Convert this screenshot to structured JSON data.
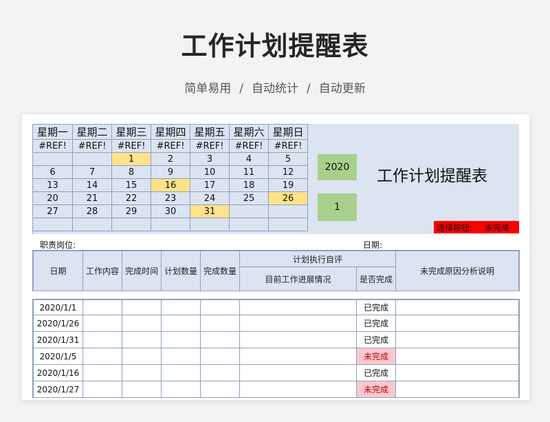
{
  "page": {
    "title": "工作计划提醒表",
    "subtitle": [
      "简单易用",
      "自动统计",
      "自动更新"
    ],
    "separator": "/"
  },
  "calendar": {
    "weekdays": [
      "星期一",
      "星期二",
      "星期三",
      "星期四",
      "星期五",
      "星期六",
      "星期日"
    ],
    "ref_row": [
      "#REF!",
      "#REF!",
      "#REF!",
      "#REF!",
      "#REF!",
      "#REF!",
      "#REF!"
    ],
    "weeks": [
      [
        "",
        "",
        "1",
        "2",
        "3",
        "4",
        "5"
      ],
      [
        "6",
        "7",
        "8",
        "9",
        "10",
        "11",
        "12"
      ],
      [
        "13",
        "14",
        "15",
        "16",
        "17",
        "18",
        "19"
      ],
      [
        "20",
        "21",
        "22",
        "23",
        "24",
        "25",
        "26"
      ],
      [
        "27",
        "28",
        "29",
        "30",
        "31",
        "",
        ""
      ],
      [
        "",
        "",
        "",
        "",
        "",
        "",
        ""
      ]
    ],
    "highlighted_days": [
      "1",
      "16",
      "26",
      "31"
    ],
    "highlight_color": "#ffe38a",
    "year": "2020",
    "month": "1",
    "sheet_title": "工作计划提醒表",
    "select_label": "选择按钮:",
    "select_value": "未完成",
    "select_color": "#ff0000"
  },
  "info": {
    "position_label": "职责岗位:",
    "date_label": "日期:"
  },
  "table": {
    "headers": {
      "date": "日期",
      "content": "工作内容",
      "finish_time": "完成时间",
      "plan_qty": "计划数量",
      "done_qty": "完成数量",
      "group": "计划执行自评",
      "progress": "目前工作进展情况",
      "is_done": "是否完成",
      "reason": "未完成原因分析说明"
    },
    "rows": [
      {
        "date": "2020/1/1",
        "status": "已完成"
      },
      {
        "date": "2020/1/26",
        "status": "已完成"
      },
      {
        "date": "2020/1/31",
        "status": "已完成"
      },
      {
        "date": "2020/1/5",
        "status": "未完成"
      },
      {
        "date": "2020/1/16",
        "status": "已完成"
      },
      {
        "date": "2020/1/27",
        "status": "未完成"
      }
    ],
    "incomplete_color": "#f9c9cf"
  }
}
